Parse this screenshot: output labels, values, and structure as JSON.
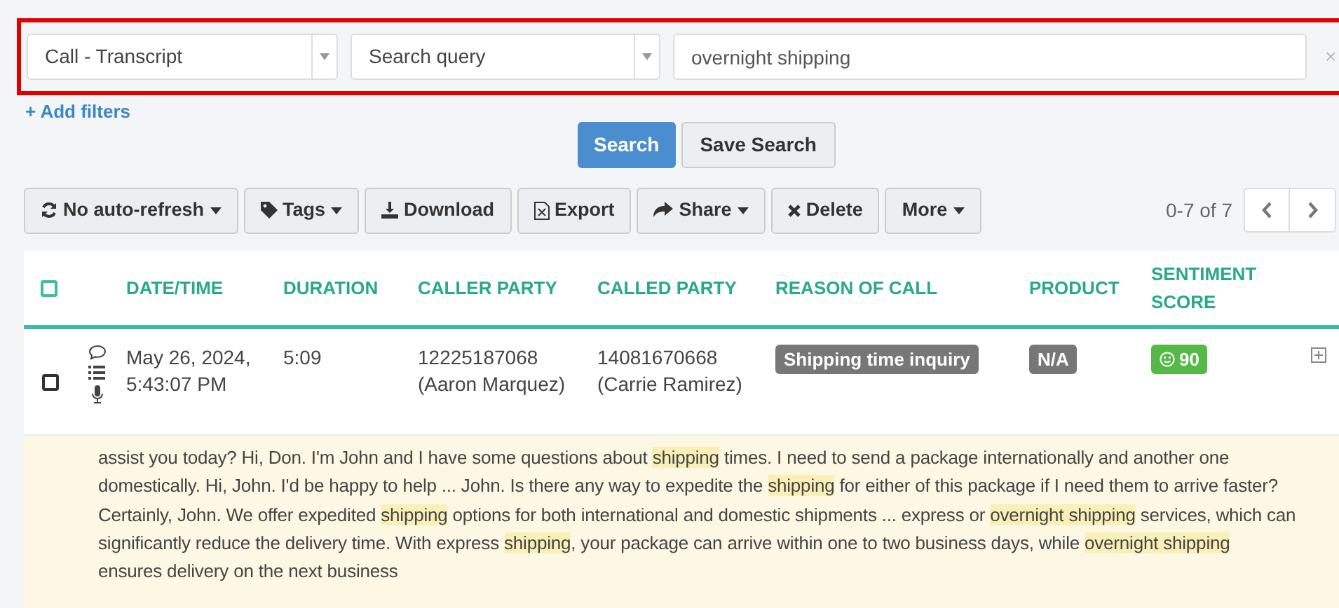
{
  "filters": {
    "field": "Call - Transcript",
    "operator": "Search query",
    "value": "overnight shipping",
    "clear": "×"
  },
  "add_filters": "+ Add filters",
  "search_buttons": [
    "Search",
    "Save Search"
  ],
  "toolbar": [
    {
      "kind": "refresh",
      "label": "No auto-refresh",
      "dropdown": true
    },
    {
      "kind": "tag",
      "label": "Tags",
      "dropdown": true
    },
    {
      "kind": "download",
      "label": "Download",
      "dropdown": false
    },
    {
      "kind": "export",
      "label": "Export",
      "dropdown": false
    },
    {
      "kind": "share",
      "label": "Share",
      "dropdown": true
    },
    {
      "kind": "delete",
      "label": "Delete",
      "dropdown": false
    },
    {
      "kind": "none",
      "label": "More",
      "dropdown": true
    }
  ],
  "pagination": {
    "range": "0-7 of 7"
  },
  "table": {
    "select_all_checked": false,
    "columns": [
      "DATE/TIME",
      "DURATION",
      "CALLER PARTY",
      "CALLED PARTY",
      "REASON OF CALL",
      "PRODUCT",
      "SENTIMENT SCORE"
    ],
    "rows": [
      {
        "checked": false,
        "date": "May 26, 2024,",
        "time": "5:43:07 PM",
        "duration": "5:09",
        "caller_number": "12225187068",
        "caller_name": "(Aaron Marquez)",
        "called_number": "14081670668",
        "called_name": "(Carrie Ramirez)",
        "reason": "Shipping time inquiry",
        "product": "N/A",
        "sentiment": "90",
        "transcript": [
          {
            "text": "assist you today? Hi, Don. I'm John and I have some questions about ",
            "highlight": false
          },
          {
            "text": "shipping",
            "highlight": true
          },
          {
            "text": " times. I need to send a package internationally and another one domestically. Hi, John. I'd be happy to help ... John. Is there any way to expedite the ",
            "highlight": false
          },
          {
            "text": "shipping",
            "highlight": true
          },
          {
            "text": " for either of this package if I need them to arrive faster? Certainly, John. We offer expedited ",
            "highlight": false
          },
          {
            "text": "shipping",
            "highlight": true
          },
          {
            "text": " options for both international and domestic shipments ... express or ",
            "highlight": false
          },
          {
            "text": "overnight ",
            "highlight": true
          },
          {
            "text": "shipping",
            "highlight": true
          },
          {
            "text": " services, which can significantly reduce the delivery time. With express ",
            "highlight": false
          },
          {
            "text": "shipping",
            "highlight": true
          },
          {
            "text": ", your package can arrive within one to two business days, while ",
            "highlight": false
          },
          {
            "text": "overnight ",
            "highlight": true
          },
          {
            "text": "shipping",
            "highlight": true
          },
          {
            "text": " ensures delivery on the next business",
            "highlight": false
          }
        ]
      }
    ]
  }
}
